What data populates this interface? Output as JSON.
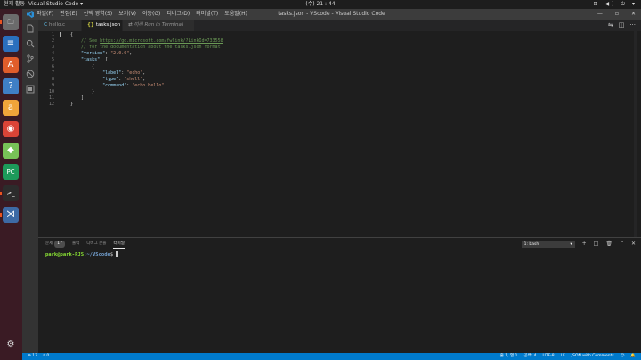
{
  "topbar": {
    "activities": "현재 활동",
    "app_menu": "Visual Studio Code ▾",
    "clock": "(수) 21 : 44",
    "tray": "⊞ ◀) ⏻ ▾"
  },
  "dock": {
    "items": [
      {
        "name": "files",
        "icon": "🗀",
        "color": "#6b6b6b"
      },
      {
        "name": "libreoffice-writer",
        "icon": "≡",
        "color": "#2a6fbd"
      },
      {
        "name": "ubuntu-software",
        "icon": "A",
        "color": "#e05d2b"
      },
      {
        "name": "help",
        "icon": "?",
        "color": "#3f7fc6"
      },
      {
        "name": "amazon",
        "icon": "a",
        "color": "#f0a43a"
      },
      {
        "name": "chrome",
        "icon": "◉",
        "color": "#db4437"
      },
      {
        "name": "android-studio",
        "icon": "◆",
        "color": "#78c257"
      },
      {
        "name": "pycharm",
        "icon": "PC",
        "color": "#1d9a5a"
      },
      {
        "name": "terminal",
        "icon": ">_",
        "color": "#2c2c2c"
      },
      {
        "name": "vscode",
        "icon": "⋊",
        "color": "#3d6aa5"
      }
    ],
    "settings_icon": "⚙"
  },
  "window": {
    "menu": [
      "파일(F)",
      "편집(E)",
      "선택 영역(S)",
      "보기(V)",
      "이동(G)",
      "디버그(D)",
      "터미널(T)",
      "도움말(H)"
    ],
    "title": "tasks.json - VScode - Visual Studio Code",
    "controls": [
      "—",
      "▫",
      "✕"
    ]
  },
  "tabs": [
    {
      "icon": "C",
      "label": "hello.c",
      "active": false
    },
    {
      "icon": "{}",
      "label": "tasks.json",
      "active": true
    },
    {
      "icon": "⇄",
      "label": "미리 Run in Terminal",
      "active": false
    }
  ],
  "editor": {
    "line_numbers": [
      "1",
      "2",
      "3",
      "4",
      "5",
      "6",
      "7",
      "8",
      "9",
      "10",
      "11",
      "12"
    ],
    "lines": [
      [
        {
          "t": "{",
          "c": ""
        }
      ],
      [
        {
          "t": "    // See ",
          "c": "c-com"
        },
        {
          "t": "https://go.microsoft.com/fwlink/?LinkId=733558",
          "c": "c-link"
        }
      ],
      [
        {
          "t": "    // for the documentation about the tasks.json format",
          "c": "c-com"
        }
      ],
      [
        {
          "t": "    ",
          "c": ""
        },
        {
          "t": "\"version\"",
          "c": "c-key"
        },
        {
          "t": ": ",
          "c": ""
        },
        {
          "t": "\"2.0.0\"",
          "c": "c-str"
        },
        {
          "t": ",",
          "c": ""
        }
      ],
      [
        {
          "t": "    ",
          "c": ""
        },
        {
          "t": "\"tasks\"",
          "c": "c-key"
        },
        {
          "t": ": [",
          "c": ""
        }
      ],
      [
        {
          "t": "        {",
          "c": ""
        }
      ],
      [
        {
          "t": "            ",
          "c": ""
        },
        {
          "t": "\"label\"",
          "c": "c-key"
        },
        {
          "t": ": ",
          "c": ""
        },
        {
          "t": "\"echo\"",
          "c": "c-str"
        },
        {
          "t": ",",
          "c": ""
        }
      ],
      [
        {
          "t": "            ",
          "c": ""
        },
        {
          "t": "\"type\"",
          "c": "c-key"
        },
        {
          "t": ": ",
          "c": ""
        },
        {
          "t": "\"shell\"",
          "c": "c-str"
        },
        {
          "t": ",",
          "c": ""
        }
      ],
      [
        {
          "t": "            ",
          "c": ""
        },
        {
          "t": "\"command\"",
          "c": "c-key"
        },
        {
          "t": ": ",
          "c": ""
        },
        {
          "t": "\"echo Hello\"",
          "c": "c-str"
        }
      ],
      [
        {
          "t": "        }",
          "c": ""
        }
      ],
      [
        {
          "t": "    ]",
          "c": ""
        }
      ],
      [
        {
          "t": "}",
          "c": ""
        }
      ]
    ]
  },
  "panel": {
    "tabs": [
      {
        "label": "문제",
        "badge": "17",
        "active": false
      },
      {
        "label": "출력",
        "badge": "",
        "active": false
      },
      {
        "label": "디버그 콘솔",
        "badge": "",
        "active": false
      },
      {
        "label": "터미널",
        "badge": "",
        "active": true
      }
    ],
    "terminal_select": "1: bash",
    "terminal": {
      "user": "park@park-PJS",
      "path": ":~/VScode",
      "prompt": "$"
    }
  },
  "statusbar": {
    "errors": "⊗ 17",
    "warnings": "⚠ 0",
    "position": "줄 1, 열 1",
    "spaces": "공백: 4",
    "encoding": "UTF-8",
    "eol": "LF",
    "language": "JSON with Comments",
    "feedback": "☺",
    "bell": "🔔"
  },
  "colors": {
    "accent": "#007acc",
    "dock_bg": "#3a1b24",
    "editor_bg": "#1e1e1e"
  }
}
